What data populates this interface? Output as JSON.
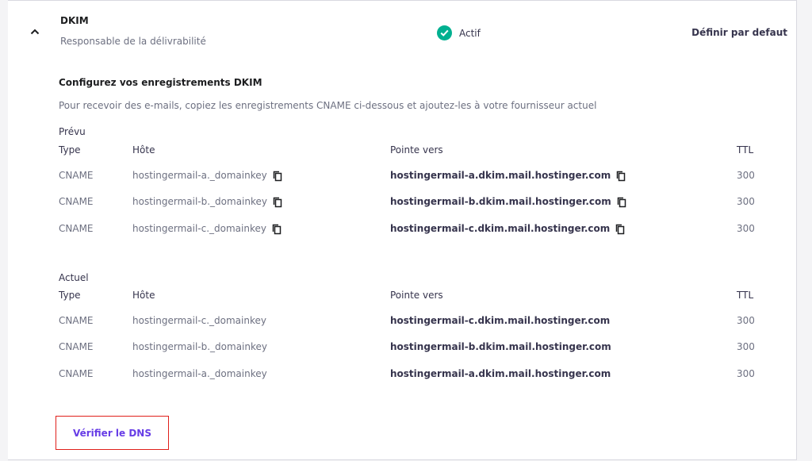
{
  "header": {
    "title": "DKIM",
    "subtitle": "Responsable de la délivrabilité",
    "status": "Actif",
    "set_default": "Définir par defaut"
  },
  "section": {
    "title": "Configurez vos enregistrements DKIM",
    "description": "Pour recevoir des e-mails, copiez les enregistrements CNAME ci-dessous et ajoutez-les à votre fournisseur actuel"
  },
  "columns": {
    "type": "Type",
    "host": "Hôte",
    "points_to": "Pointe vers",
    "ttl": "TTL"
  },
  "expected": {
    "label": "Prévu",
    "rows": [
      {
        "type": "CNAME",
        "host": "hostingermail-a._domainkey",
        "points_to": "hostingermail-a.dkim.mail.hostinger.com",
        "ttl": "300"
      },
      {
        "type": "CNAME",
        "host": "hostingermail-b._domainkey",
        "points_to": "hostingermail-b.dkim.mail.hostinger.com",
        "ttl": "300"
      },
      {
        "type": "CNAME",
        "host": "hostingermail-c._domainkey",
        "points_to": "hostingermail-c.dkim.mail.hostinger.com",
        "ttl": "300"
      }
    ]
  },
  "current": {
    "label": "Actuel",
    "rows": [
      {
        "type": "CNAME",
        "host": "hostingermail-c._domainkey",
        "points_to": "hostingermail-c.dkim.mail.hostinger.com",
        "ttl": "300"
      },
      {
        "type": "CNAME",
        "host": "hostingermail-b._domainkey",
        "points_to": "hostingermail-b.dkim.mail.hostinger.com",
        "ttl": "300"
      },
      {
        "type": "CNAME",
        "host": "hostingermail-a._domainkey",
        "points_to": "hostingermail-a.dkim.mail.hostinger.com",
        "ttl": "300"
      }
    ]
  },
  "actions": {
    "verify_dns": "Vérifier le DNS"
  },
  "colors": {
    "accent": "#673de6",
    "success": "#00b090",
    "highlight_border": "#e0201b"
  },
  "icons": {
    "collapse": "chevron-up-icon",
    "status": "check-circle-icon",
    "copy": "copy-icon"
  }
}
